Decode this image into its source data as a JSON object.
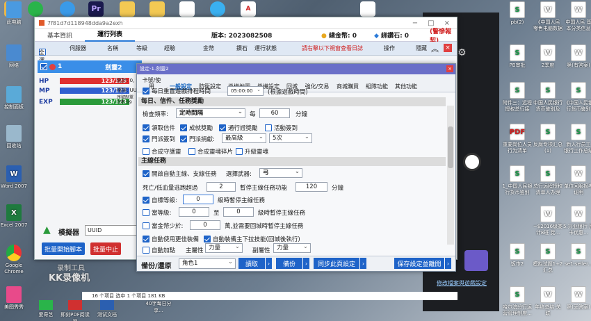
{
  "desktop_left": [
    {
      "label": "此电脑",
      "icon": "computer-icon"
    },
    {
      "label": "网络",
      "icon": "network-icon"
    },
    {
      "label": "控制面板",
      "icon": "control-panel-icon"
    },
    {
      "label": "回收站",
      "icon": "recycle-bin-icon"
    },
    {
      "label": "Word 2007",
      "icon": "word-icon"
    },
    {
      "label": "Excel 2007",
      "icon": "excel-icon"
    },
    {
      "label": "Google Chrome",
      "icon": "chrome-icon"
    },
    {
      "label": "美图秀秀",
      "icon": "meitu-icon"
    }
  ],
  "desktop_right": [
    {
      "label": "pb(2)",
      "type": "S"
    },
    {
      "label": "《中国人民 零售电脑数据",
      "type": "W"
    },
    {
      "label": "中国人民 基本分类信息",
      "type": "W"
    },
    {
      "label": "PB审批",
      "type": "S"
    },
    {
      "label": "2季度",
      "type": "W"
    },
    {
      "label": "第(有答案)",
      "type": "W"
    },
    {
      "label": "附件三：远程 授权总行接",
      "type": "S"
    },
    {
      "label": "中国人民银行 货币鉴别及",
      "type": "S"
    },
    {
      "label": "《中国人民银 行货币鉴别",
      "type": "S"
    },
    {
      "label": "重要岗位人员 行为清单",
      "type": "P"
    },
    {
      "label": "反腐专项汇总 (1)",
      "type": "S"
    },
    {
      "label": "新入行员工 银行工作总结",
      "type": "S"
    },
    {
      "label": "1_中国人民银 行货币鉴别",
      "type": "S"
    },
    {
      "label": "总行远程授权 清单人办理",
      "type": "S"
    },
    {
      "label": "单位回服报考 证明",
      "type": "W"
    },
    {
      "label": "~$2016级委 计8班 党...",
      "type": "W"
    },
    {
      "label": "5.兴业银行 用卡优惠...",
      "type": "W"
    },
    {
      "label": "饭市2",
      "type": "S"
    },
    {
      "label": "模拟试题1+2 汇总",
      "type": "S"
    },
    {
      "label": "se1-seller...",
      "type": "S"
    },
    {
      "label": "哈尔滨分行运 营管理制度...",
      "type": "S"
    },
    {
      "label": "年终总结-关 联",
      "type": "W"
    },
    {
      "label": "第(无答案)",
      "type": "W"
    }
  ],
  "main": {
    "title": "7f81d7d118948dda9a2exh",
    "tabs": [
      "基本資訊",
      "運行列表"
    ],
    "version": "版本: 2023082508",
    "total_gold": "總金幣: 0",
    "bound_diamond": "綁鑽石: 0",
    "warn_link": "(警慘報契)",
    "columns": [
      "全選",
      "伺服器",
      "名稱",
      "等級",
      "經驗",
      "金幣",
      "鑽石",
      "運行狀態"
    ],
    "log_hint": "請右擊以下視窗查看日誌",
    "op_col": "操作",
    "hide_col": "隱藏",
    "row_index": "1",
    "row_server": "劍靈2",
    "hp_label": "HP",
    "hp_value": "123/123",
    "mp_label": "MP",
    "mp_value": "123/123",
    "exp_label": "EXP",
    "exp_value": "123/123",
    "stat1": "統計: 0,",
    "stat2": "種族: UU",
    "stat3": "序號制單\n次數:99",
    "simulator_label": "模擬器",
    "simulator_value": "UUID",
    "batch_start": "批量開始腳本",
    "batch_stop": "批量中止",
    "watermark_sub": "录制工具",
    "watermark": "KK录像机",
    "link_text": "修改檔案與遊戲設定"
  },
  "dialog": {
    "title": "設定-1.劍靈2",
    "tabs": [
      "卡號/使用",
      "一般設定",
      "防衛設定",
      "掛機地圖",
      "掛機設定",
      "回城",
      "強化/交易",
      "商城購買",
      "組隊功能",
      "其他功能"
    ],
    "active_tab": "一般設定",
    "top_row": "每日重置遊戲排程時間",
    "top_time": "05:00:00",
    "top_note": "(根據遊戲時間)",
    "sect_daily": "每日、信件、任務獎勵",
    "check_freq_label": "檢查頻率:",
    "check_freq_value": "定時間隔",
    "every_label": "每",
    "every_value": "60",
    "minute": "分鐘",
    "cb_mail": "領取信件",
    "cb_achv": "成就獎勵",
    "cb_pass": "通行證獎勵",
    "cb_event": "活動簽到",
    "cb_guild_sign": "門派簽到",
    "cb_guild_donate": "門派捐獻:",
    "donate_value": "最高級",
    "donate_times": "5次",
    "cb_compose_guard": "合成守護靈",
    "cb_compose_soul": "合成靈魂碎片",
    "cb_upgrade_soul": "升級靈魂",
    "sect_main": "主線任務",
    "cb_auto_main": "開啟自動主線、支線任務",
    "weapon_label": "選擇武器:",
    "weapon_value": "弓",
    "death_label": "死亡/低血量逃跑超過",
    "death_value": "2",
    "pause_label": "暫停主線任務功能",
    "pause_value": "120",
    "cb_target_level": "自標等級:",
    "target_level_value": "0",
    "target_level_note": "級時暫停主線任務",
    "cb_level_range": "當等級:",
    "range_from": "0",
    "range_to_label": "至",
    "range_to": "0",
    "range_note": "級時暫停主線任務",
    "cb_gold_low": "當金幣少於:",
    "gold_value": "0",
    "gold_note": "萬,並需要回城時暫停主線任務",
    "cb_auto_equip": "自動使用更佳裝備",
    "cb_auto_skill": "自動裝備主下拉技能(回城後執行)",
    "cb_auto_point": "自動加點",
    "main_attr_label": "主屬性",
    "main_attr_value": "力量",
    "sub_attr_label": "副屬性",
    "sub_attr_value": "力量",
    "backup_label": "備份/還原",
    "role_value": "角色1",
    "read_btn": "讀取",
    "backup_btn": "備份",
    "sync_btn": "同步此頁設定",
    "save_btn": "保存設定並離開"
  },
  "taskbar": {
    "items": [
      "爱奇艺",
      "即刻PDF阅读器",
      "测试文档",
      "40字每日分享..."
    ],
    "status": "16 个项目   选中 1 个项目 181 KB"
  }
}
